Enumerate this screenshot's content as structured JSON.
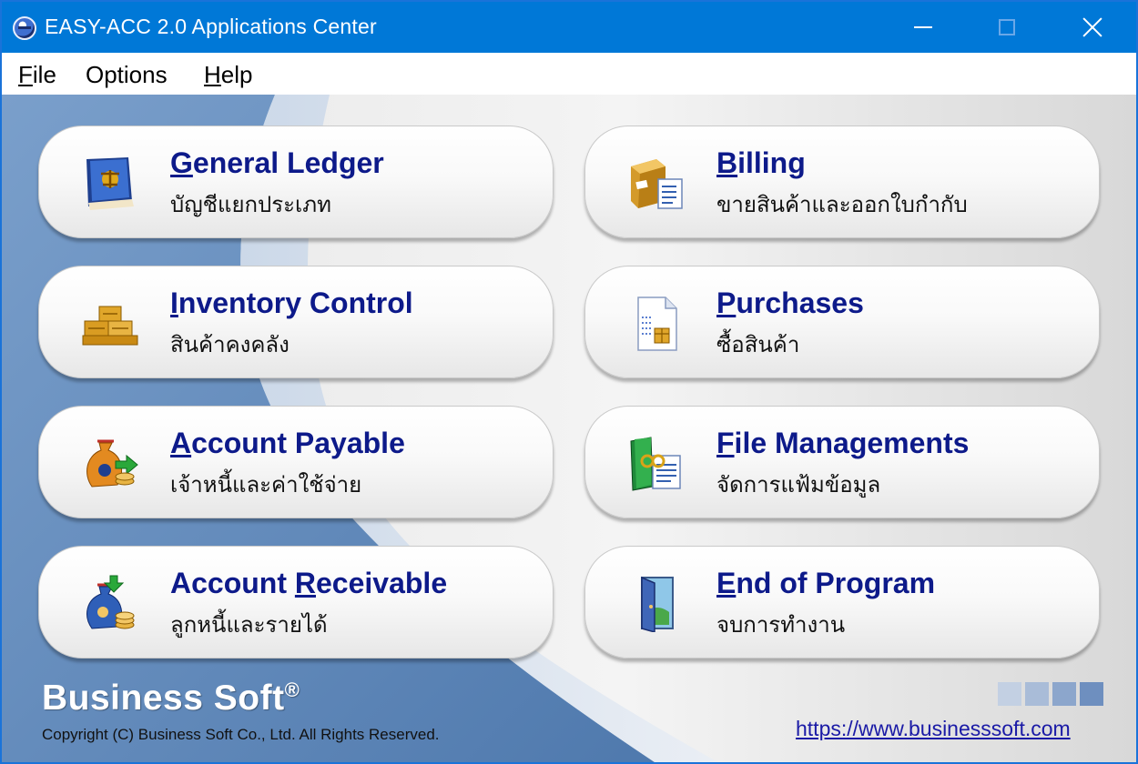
{
  "window": {
    "title": "EASY-ACC 2.0 Applications Center"
  },
  "menu": {
    "file": {
      "mnemonic": "F",
      "rest": "ile"
    },
    "options": {
      "label": "Options"
    },
    "help": {
      "mnemonic": "H",
      "rest": "elp"
    }
  },
  "modules": [
    {
      "id": "general-ledger",
      "pre": "",
      "mnemonic": "G",
      "post": "eneral Ledger",
      "thai": "บัญชีแยกประเภท",
      "icon": "ledger-book-icon"
    },
    {
      "id": "billing",
      "pre": "",
      "mnemonic": "B",
      "post": "illing",
      "thai": "ขายสินค้าและออกใบกำกับ",
      "icon": "billing-package-icon"
    },
    {
      "id": "inventory-control",
      "pre": "",
      "mnemonic": "I",
      "post": "nventory Control",
      "thai": "สินค้าคงคลัง",
      "icon": "inventory-boxes-icon"
    },
    {
      "id": "purchases",
      "pre": "",
      "mnemonic": "P",
      "post": "urchases",
      "thai": "ซื้อสินค้า",
      "icon": "purchase-document-icon"
    },
    {
      "id": "account-payable",
      "pre": "",
      "mnemonic": "A",
      "post": "ccount Payable",
      "thai": "เจ้าหนี้และค่าใช้จ่าย",
      "icon": "money-bag-out-icon"
    },
    {
      "id": "file-managements",
      "pre": "",
      "mnemonic": "F",
      "post": "ile Managements",
      "thai": "จัดการแฟ้มข้อมูล",
      "icon": "file-binder-icon"
    },
    {
      "id": "account-receivable",
      "pre": "Account ",
      "mnemonic": "R",
      "post": "eceivable",
      "thai": "ลูกหนี้และรายได้",
      "icon": "money-bag-in-icon"
    },
    {
      "id": "end-of-program",
      "pre": "",
      "mnemonic": "E",
      "post": "nd of Program",
      "thai": "จบการทำงาน",
      "icon": "exit-door-icon"
    }
  ],
  "footer": {
    "brand": "Business Soft",
    "registered": "®",
    "copyright": "Copyright (C) Business Soft Co., Ltd. All Rights Reserved.",
    "website": "https://www.businesssoft.com"
  },
  "colors": {
    "titlebar": "#0078d7",
    "module_title": "#0d1a8a",
    "link": "#1a1aa6",
    "background_blue": "#5b86b8"
  }
}
